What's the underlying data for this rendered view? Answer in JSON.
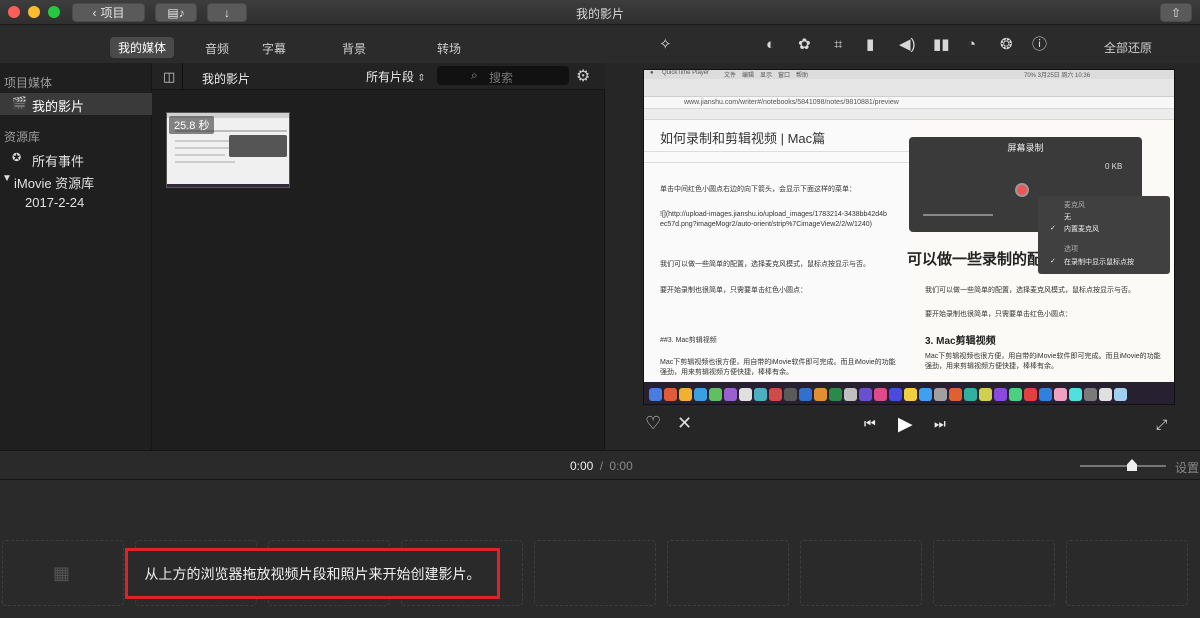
{
  "window": {
    "title": "我的影片",
    "back_label": "项目"
  },
  "tabs": [
    {
      "label": "我的媒体",
      "active": true
    },
    {
      "label": "音频"
    },
    {
      "label": "字幕"
    },
    {
      "label": "背景"
    },
    {
      "label": "转场"
    }
  ],
  "viewer_toolbar": {
    "restore_all_label": "全部还原"
  },
  "sidebar": {
    "project_media_header": "项目媒体",
    "project_item": "我的影片",
    "library_header": "资源库",
    "all_events": "所有事件",
    "library_name": "iMovie 资源库",
    "event_date": "2017-2-24"
  },
  "browser": {
    "title": "我的影片",
    "filter": "所有片段",
    "search_placeholder": "搜索",
    "clip_duration": "25.8 秒"
  },
  "preview": {
    "menubar": [
      "QuickTime Player",
      "文件",
      "编辑",
      "显示",
      "窗口",
      "帮助"
    ],
    "menubar_right": "70%  3月25日 周六 10:36",
    "url": "www.jianshu.com/writer#/notebooks/5841098/notes/9810881/preview",
    "article_title": "如何录制和剪辑视频 | Mac篇",
    "edit_lines": [
      "单击中间红色小圆点右边的向下箭头，会显示下面这样的菜单：",
      "![](http://upload-images.jianshu.io/upload_images/1783214-3438bb42d4bec57d.png?imageMogr2/auto-orient/strip%7CimageView2/2/w/1240)",
      "我们可以做一些简单的配置，选择麦克风模式，鼠标点按显示与否。",
      "要开始录制也很简单，只需要单击红色小圆点：",
      "##3. Mac剪辑视频",
      "Mac下剪辑视频也很方便，用自带的iMovie软件即可完成。而且iMovie的功能强劲，用来剪辑视频方便快捷，棒棒有余。"
    ],
    "recording": {
      "title": "屏幕录制",
      "size": "0 KB",
      "mic_header": "麦克风",
      "mic_none": "无",
      "mic_builtin": "内置麦克风",
      "options_header": "选项",
      "show_clicks": "在录制中显示鼠标点按"
    },
    "big_heading": "可以做一些录制的配",
    "right_lines": [
      "我们可以做一些简单的配置，选择麦克风模式，鼠标点按显示与否。",
      "要开始录制也很简单，只需要单击红色小圆点："
    ],
    "right_heading": "3. Mac剪辑视频",
    "right_para": "Mac下剪辑视频也很方便，用自带的iMovie软件即可完成。而且iMovie的功能强劲，用来剪辑视频方便快捷，棒棒有余。"
  },
  "timeline": {
    "current_time": "0:00",
    "separator": "/",
    "total_time": "0:00",
    "settings_label": "设置",
    "hint": "从上方的浏览器拖放视频片段和照片来开始创建影片。"
  },
  "colors": {
    "accent_red": "#e0202a",
    "selection": "#3a3a3a"
  }
}
